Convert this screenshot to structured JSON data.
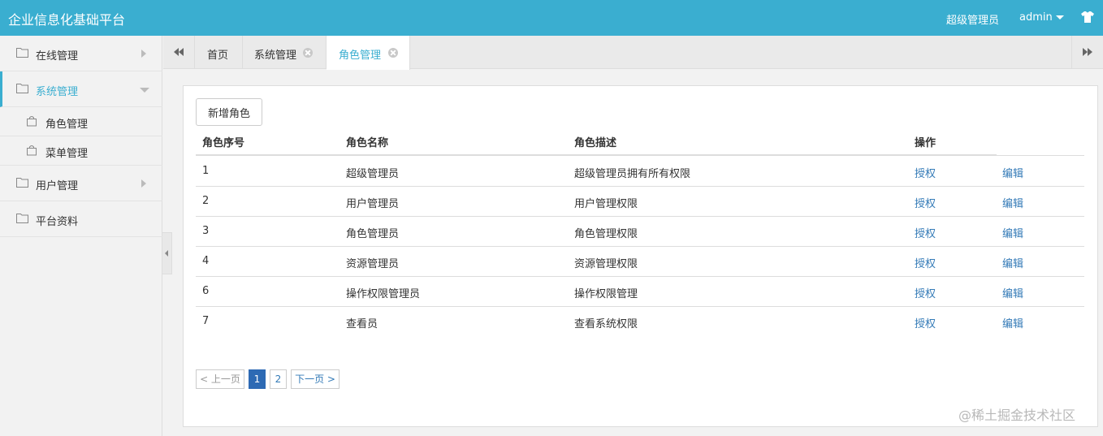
{
  "app": {
    "title": "企业信息化基础平台",
    "role": "超级管理员",
    "user": "admin",
    "accent_color": "#3aaed0",
    "shirt_icon": "shirt-icon"
  },
  "sidebar": {
    "items": [
      {
        "label": "在线管理",
        "icon": "folder-icon",
        "state": "collapsed"
      },
      {
        "label": "系统管理",
        "icon": "folder-icon",
        "state": "expanded",
        "active": true,
        "children": [
          {
            "label": "角色管理",
            "icon": "bag-icon"
          },
          {
            "label": "菜单管理",
            "icon": "bag-icon"
          }
        ]
      },
      {
        "label": "用户管理",
        "icon": "folder-icon",
        "state": "collapsed"
      },
      {
        "label": "平台资料",
        "icon": "folder-icon"
      }
    ]
  },
  "tabs": [
    {
      "label": "首页",
      "closable": false
    },
    {
      "label": "系统管理",
      "closable": true
    },
    {
      "label": "角色管理",
      "closable": true,
      "active": true
    }
  ],
  "toolbar": {
    "add_label": "新增角色"
  },
  "table": {
    "headers": [
      "角色序号",
      "角色名称",
      "角色描述",
      "操作"
    ],
    "rows": [
      {
        "id": "1",
        "name": "超级管理员",
        "desc": "超级管理员拥有所有权限",
        "auth": "授权",
        "edit": "编辑"
      },
      {
        "id": "2",
        "name": "用户管理员",
        "desc": "用户管理权限",
        "auth": "授权",
        "edit": "编辑"
      },
      {
        "id": "3",
        "name": "角色管理员",
        "desc": "角色管理权限",
        "auth": "授权",
        "edit": "编辑"
      },
      {
        "id": "4",
        "name": "资源管理员",
        "desc": "资源管理权限",
        "auth": "授权",
        "edit": "编辑"
      },
      {
        "id": "6",
        "name": "操作权限管理员",
        "desc": "操作权限管理",
        "auth": "授权",
        "edit": "编辑"
      },
      {
        "id": "7",
        "name": "查看员",
        "desc": "查看系统权限",
        "auth": "授权",
        "edit": "编辑"
      }
    ]
  },
  "pagination": {
    "prev": "< 上一页",
    "pages": [
      "1",
      "2"
    ],
    "current": "1",
    "next": "下一页 >"
  },
  "watermark": "@稀土掘金技术社区"
}
